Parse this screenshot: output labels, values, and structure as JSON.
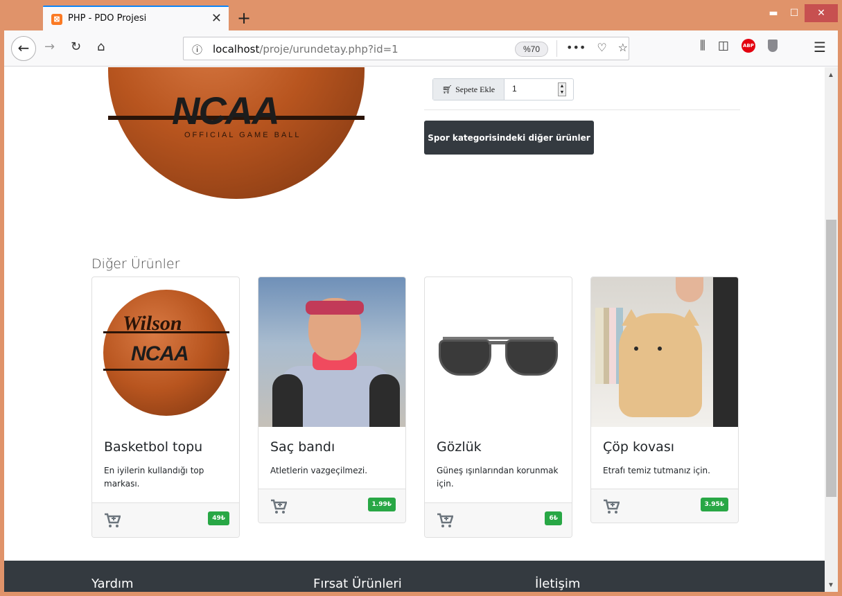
{
  "browser": {
    "tab_title": "PHP - PDO Projesi",
    "tab_close": "✕",
    "new_tab": "+",
    "url_host": "localhost",
    "url_path": "/proje/urundetay.php?id=1",
    "zoom": "%70",
    "window_controls": {
      "minimize": "▬",
      "maximize": "☐",
      "close": "✕"
    }
  },
  "product": {
    "add_to_cart_label": "Sepete Ekle",
    "quantity": "1",
    "category_button": "Spor kategorisindeki diğer ürünler"
  },
  "other_products": {
    "title": "Diğer Ürünler",
    "items": [
      {
        "name": "Basketbol topu",
        "description": "En iyilerin kullandığı top markası.",
        "price": "49₺"
      },
      {
        "name": "Saç bandı",
        "description": "Atletlerin vazgeçilmezi.",
        "price": "1.99₺"
      },
      {
        "name": "Gözlük",
        "description": "Güneş ışınlarından korunmak için.",
        "price": "6₺"
      },
      {
        "name": "Çöp kovası",
        "description": "Etrafı temiz tutmanız için.",
        "price": "3.95₺"
      }
    ]
  },
  "footer": {
    "columns": [
      "Yardım",
      "Fırsat Ürünleri",
      "İletişim"
    ]
  },
  "colors": {
    "accent_dark": "#343a40",
    "price_badge": "#28a745",
    "frame": "#e0936a"
  }
}
